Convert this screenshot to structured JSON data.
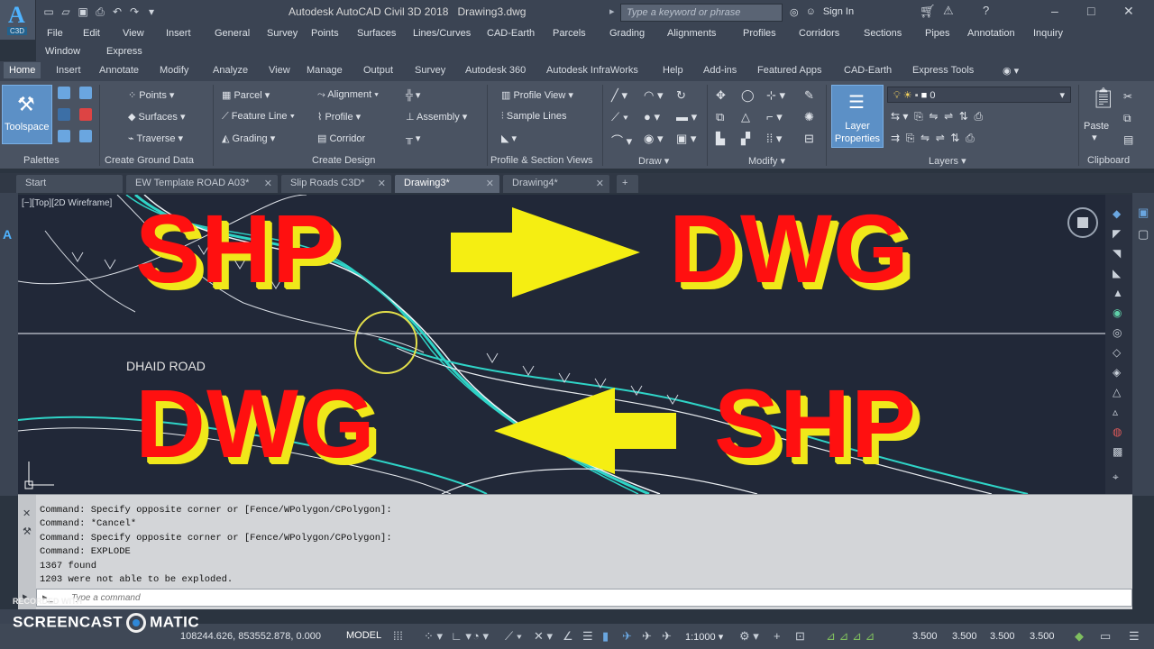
{
  "title_bar": {
    "app_badge": "C3D",
    "app_title": "Autodesk AutoCAD Civil 3D 2018",
    "document": "Drawing3.dwg",
    "search_placeholder": "Type a keyword or phrase",
    "sign_in": "Sign In"
  },
  "menu": {
    "items": [
      "File",
      "Edit",
      "View",
      "Insert",
      "General",
      "Survey",
      "Points",
      "Surfaces",
      "Lines/Curves",
      "CAD-Earth",
      "Parcels",
      "Grading",
      "Alignments",
      "Profiles",
      "Corridors",
      "Sections",
      "Pipes",
      "Annotation",
      "Inquiry"
    ],
    "items_row2": [
      "Window",
      "Express"
    ]
  },
  "ribbon_tabs": [
    "Home",
    "Insert",
    "Annotate",
    "Modify",
    "Analyze",
    "View",
    "Manage",
    "Output",
    "Survey",
    "Autodesk 360",
    "Autodesk InfraWorks",
    "Help",
    "Add-ins",
    "Featured Apps",
    "CAD-Earth",
    "Express Tools"
  ],
  "ribbon": {
    "toolspace": "Toolspace",
    "palettes_label": "Palettes",
    "ground": {
      "points": "Points",
      "surfaces": "Surfaces",
      "traverse": "Traverse",
      "label": "Create Ground Data"
    },
    "design": {
      "parcel": "Parcel",
      "feature_line": "Feature Line",
      "grading": "Grading",
      "alignment": "Alignment",
      "profile": "Profile",
      "corridor": "Corridor",
      "assembly": "Assembly",
      "label": "Create Design"
    },
    "profile_section": {
      "profile_view": "Profile View",
      "sample_lines": "Sample Lines",
      "label": "Profile & Section Views"
    },
    "draw_label": "Draw",
    "modify_label": "Modify",
    "layers": {
      "layer_properties": "Layer Properties",
      "current_layer": "0",
      "label": "Layers"
    },
    "clipboard": {
      "paste": "Paste",
      "label": "Clipboard"
    }
  },
  "file_tabs": [
    {
      "label": "Start",
      "active": false
    },
    {
      "label": "EW Template ROAD A03*",
      "active": false
    },
    {
      "label": "Slip Roads C3D*",
      "active": false
    },
    {
      "label": "Drawing3*",
      "active": true
    },
    {
      "label": "Drawing4*",
      "active": false
    }
  ],
  "viewport": {
    "label": "[−][Top][2D Wireframe]",
    "road_label": "DHAID ROAD"
  },
  "overlay": {
    "top_left": "SHP",
    "top_right": "DWG",
    "bottom_left": "DWG",
    "bottom_right": "SHP",
    "text_color": "#ff1010",
    "shadow_color": "#f0e81a",
    "arrow_color": "#f5ee12"
  },
  "command_line": {
    "history": [
      "Command: Specify opposite corner or [Fence/WPolygon/CPolygon]:",
      "Command: *Cancel*",
      "Command: Specify opposite corner or [Fence/WPolygon/CPolygon]:",
      "Command: EXPLODE",
      "1367 found",
      "1203 were not able to be exploded."
    ],
    "placeholder": "Type a command"
  },
  "watermark": {
    "recorded_with": "RECORDED WITH",
    "brand_left": "SCREENCAST",
    "brand_right": "MATIC"
  },
  "status_bar": {
    "coordinates": "108244.626, 853552.878, 0.000",
    "model": "MODEL",
    "scale": "1:1000",
    "values": [
      "3.500",
      "3.500",
      "3.500",
      "3.500"
    ]
  }
}
